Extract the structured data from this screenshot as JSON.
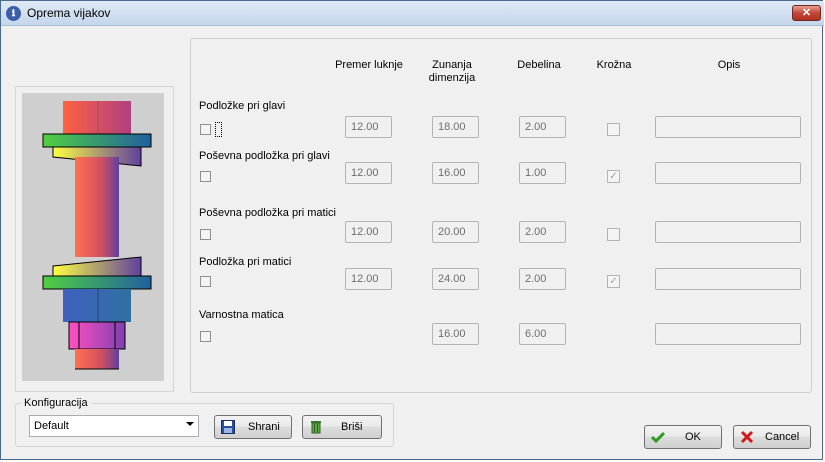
{
  "window": {
    "title": "Oprema vijakov",
    "close_label": "✕"
  },
  "columns": [
    "Premer luknje",
    "Zunanja\ndimenzija",
    "Debelina",
    "Krožna",
    "Opis"
  ],
  "rows": [
    {
      "label": "Podložke pri glavi",
      "premer": "12.00",
      "zunanja": "18.00",
      "debelina": "2.00",
      "krozna_checked": false,
      "opis": ""
    },
    {
      "label": "Poševna podložka pri glavi",
      "premer": "12.00",
      "zunanja": "16.00",
      "debelina": "1.00",
      "krozna_checked": true,
      "opis": ""
    },
    {
      "label": "Poševna podložka pri matici",
      "premer": "12.00",
      "zunanja": "20.00",
      "debelina": "2.00",
      "krozna_checked": false,
      "opis": ""
    },
    {
      "label": "Podložka pri matici",
      "premer": "12.00",
      "zunanja": "24.00",
      "debelina": "2.00",
      "krozna_checked": true,
      "opis": ""
    },
    {
      "label": "Varnostna matica",
      "zunanja": "16.00",
      "debelina": "6.00",
      "opis": ""
    }
  ],
  "config": {
    "group_label": "Konfiguracija",
    "selected": "Default",
    "save_label": "Shrani",
    "delete_label": "Briši"
  },
  "actions": {
    "ok_label": "OK",
    "cancel_label": "Cancel"
  },
  "icons": {
    "app": "app-logo-icon",
    "save": "floppy-disk-icon",
    "delete": "trash-can-icon",
    "ok": "checkmark-icon",
    "cancel": "red-x-icon"
  }
}
